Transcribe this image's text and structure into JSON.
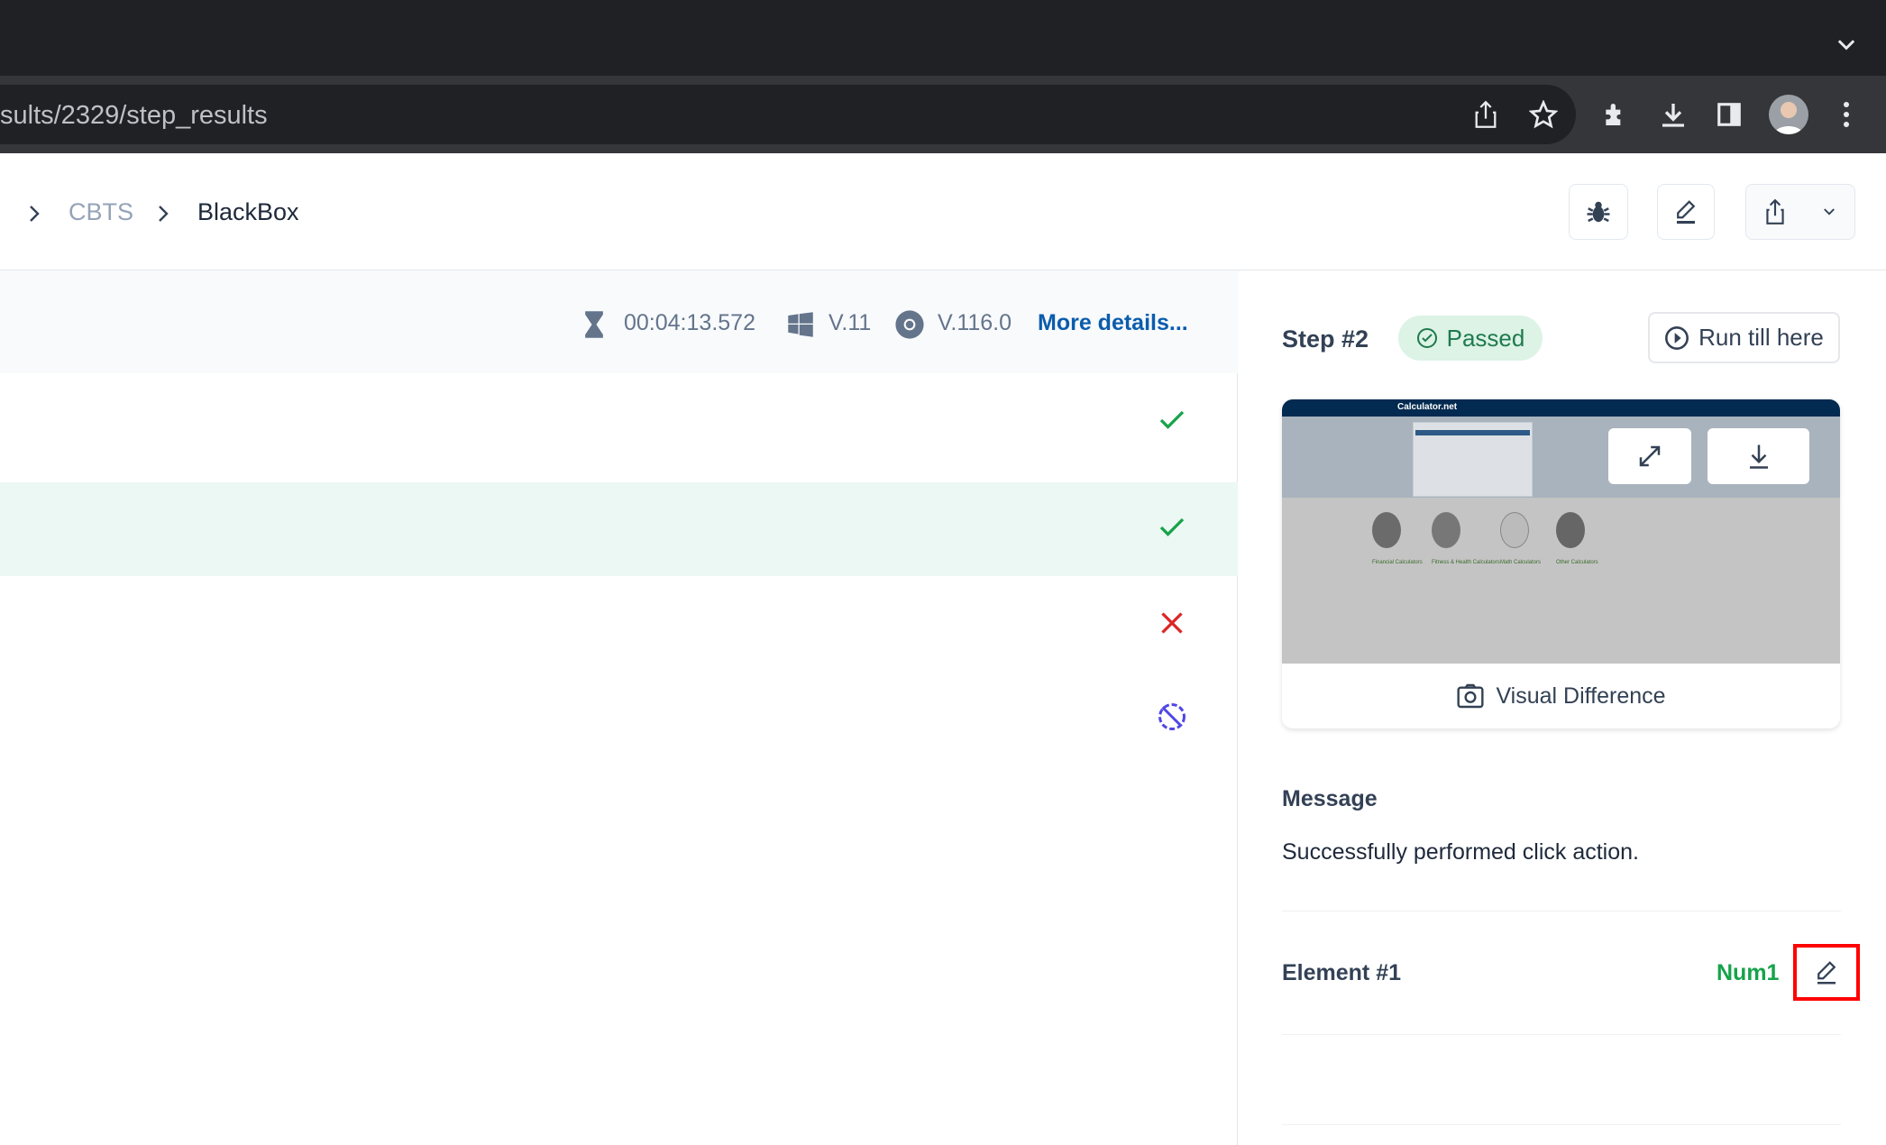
{
  "browser": {
    "url": "sults/2329/step_results"
  },
  "breadcrumb": [
    "CBTS",
    "BlackBox"
  ],
  "info": {
    "duration": "00:04:13.572",
    "os_version": "V.11",
    "browser_version": "V.116.0",
    "more_details": "More details..."
  },
  "steps": [
    {
      "status": "passed"
    },
    {
      "status": "passed",
      "selected": true
    },
    {
      "status": "failed"
    },
    {
      "status": "skipped"
    }
  ],
  "step_detail": {
    "title": "Step #2",
    "status": "Passed",
    "run_till_here": "Run till here",
    "screenshot_label": "Visual Difference",
    "screenshot": {
      "site": "Calculator.net",
      "categories": [
        "Financial Calculators",
        "Fitness & Health Calculators",
        "Math Calculators",
        "Other Calculators"
      ]
    },
    "message_heading": "Message",
    "message": "Successfully performed click action.",
    "element_label": "Element #1",
    "element_value": "Num1"
  },
  "colors": {
    "accent": "#0b5cad",
    "passed": "#16a34a",
    "failed": "#dc2626",
    "skipped": "#4f46e5",
    "highlight": "#ff0000"
  }
}
